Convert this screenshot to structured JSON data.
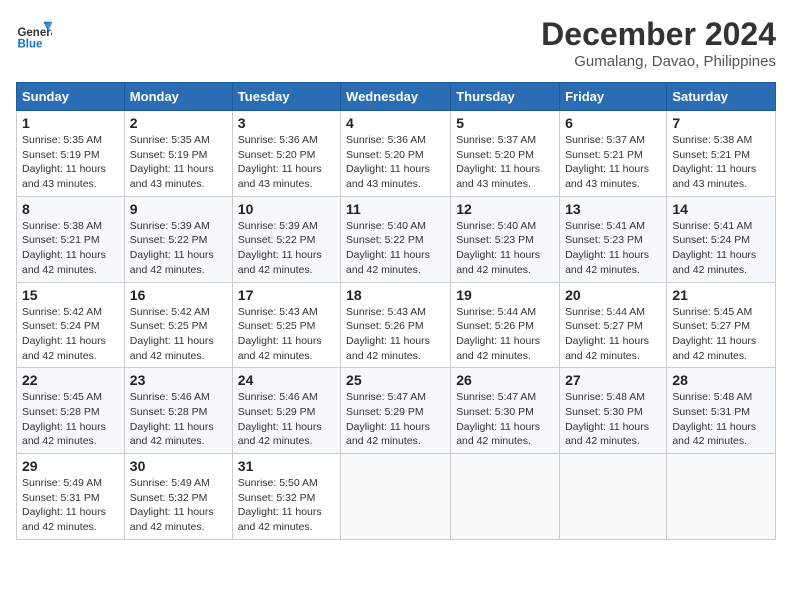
{
  "logo": {
    "line1": "General",
    "line2": "Blue"
  },
  "title": "December 2024",
  "location": "Gumalang, Davao, Philippines",
  "weekdays": [
    "Sunday",
    "Monday",
    "Tuesday",
    "Wednesday",
    "Thursday",
    "Friday",
    "Saturday"
  ],
  "weeks": [
    [
      {
        "day": "1",
        "sunrise": "5:35 AM",
        "sunset": "5:19 PM",
        "daylight": "11 hours and 43 minutes."
      },
      {
        "day": "2",
        "sunrise": "5:35 AM",
        "sunset": "5:19 PM",
        "daylight": "11 hours and 43 minutes."
      },
      {
        "day": "3",
        "sunrise": "5:36 AM",
        "sunset": "5:20 PM",
        "daylight": "11 hours and 43 minutes."
      },
      {
        "day": "4",
        "sunrise": "5:36 AM",
        "sunset": "5:20 PM",
        "daylight": "11 hours and 43 minutes."
      },
      {
        "day": "5",
        "sunrise": "5:37 AM",
        "sunset": "5:20 PM",
        "daylight": "11 hours and 43 minutes."
      },
      {
        "day": "6",
        "sunrise": "5:37 AM",
        "sunset": "5:21 PM",
        "daylight": "11 hours and 43 minutes."
      },
      {
        "day": "7",
        "sunrise": "5:38 AM",
        "sunset": "5:21 PM",
        "daylight": "11 hours and 43 minutes."
      }
    ],
    [
      {
        "day": "8",
        "sunrise": "5:38 AM",
        "sunset": "5:21 PM",
        "daylight": "11 hours and 42 minutes."
      },
      {
        "day": "9",
        "sunrise": "5:39 AM",
        "sunset": "5:22 PM",
        "daylight": "11 hours and 42 minutes."
      },
      {
        "day": "10",
        "sunrise": "5:39 AM",
        "sunset": "5:22 PM",
        "daylight": "11 hours and 42 minutes."
      },
      {
        "day": "11",
        "sunrise": "5:40 AM",
        "sunset": "5:22 PM",
        "daylight": "11 hours and 42 minutes."
      },
      {
        "day": "12",
        "sunrise": "5:40 AM",
        "sunset": "5:23 PM",
        "daylight": "11 hours and 42 minutes."
      },
      {
        "day": "13",
        "sunrise": "5:41 AM",
        "sunset": "5:23 PM",
        "daylight": "11 hours and 42 minutes."
      },
      {
        "day": "14",
        "sunrise": "5:41 AM",
        "sunset": "5:24 PM",
        "daylight": "11 hours and 42 minutes."
      }
    ],
    [
      {
        "day": "15",
        "sunrise": "5:42 AM",
        "sunset": "5:24 PM",
        "daylight": "11 hours and 42 minutes."
      },
      {
        "day": "16",
        "sunrise": "5:42 AM",
        "sunset": "5:25 PM",
        "daylight": "11 hours and 42 minutes."
      },
      {
        "day": "17",
        "sunrise": "5:43 AM",
        "sunset": "5:25 PM",
        "daylight": "11 hours and 42 minutes."
      },
      {
        "day": "18",
        "sunrise": "5:43 AM",
        "sunset": "5:26 PM",
        "daylight": "11 hours and 42 minutes."
      },
      {
        "day": "19",
        "sunrise": "5:44 AM",
        "sunset": "5:26 PM",
        "daylight": "11 hours and 42 minutes."
      },
      {
        "day": "20",
        "sunrise": "5:44 AM",
        "sunset": "5:27 PM",
        "daylight": "11 hours and 42 minutes."
      },
      {
        "day": "21",
        "sunrise": "5:45 AM",
        "sunset": "5:27 PM",
        "daylight": "11 hours and 42 minutes."
      }
    ],
    [
      {
        "day": "22",
        "sunrise": "5:45 AM",
        "sunset": "5:28 PM",
        "daylight": "11 hours and 42 minutes."
      },
      {
        "day": "23",
        "sunrise": "5:46 AM",
        "sunset": "5:28 PM",
        "daylight": "11 hours and 42 minutes."
      },
      {
        "day": "24",
        "sunrise": "5:46 AM",
        "sunset": "5:29 PM",
        "daylight": "11 hours and 42 minutes."
      },
      {
        "day": "25",
        "sunrise": "5:47 AM",
        "sunset": "5:29 PM",
        "daylight": "11 hours and 42 minutes."
      },
      {
        "day": "26",
        "sunrise": "5:47 AM",
        "sunset": "5:30 PM",
        "daylight": "11 hours and 42 minutes."
      },
      {
        "day": "27",
        "sunrise": "5:48 AM",
        "sunset": "5:30 PM",
        "daylight": "11 hours and 42 minutes."
      },
      {
        "day": "28",
        "sunrise": "5:48 AM",
        "sunset": "5:31 PM",
        "daylight": "11 hours and 42 minutes."
      }
    ],
    [
      {
        "day": "29",
        "sunrise": "5:49 AM",
        "sunset": "5:31 PM",
        "daylight": "11 hours and 42 minutes."
      },
      {
        "day": "30",
        "sunrise": "5:49 AM",
        "sunset": "5:32 PM",
        "daylight": "11 hours and 42 minutes."
      },
      {
        "day": "31",
        "sunrise": "5:50 AM",
        "sunset": "5:32 PM",
        "daylight": "11 hours and 42 minutes."
      },
      null,
      null,
      null,
      null
    ]
  ],
  "labels": {
    "sunrise": "Sunrise:",
    "sunset": "Sunset:",
    "daylight": "Daylight:"
  }
}
